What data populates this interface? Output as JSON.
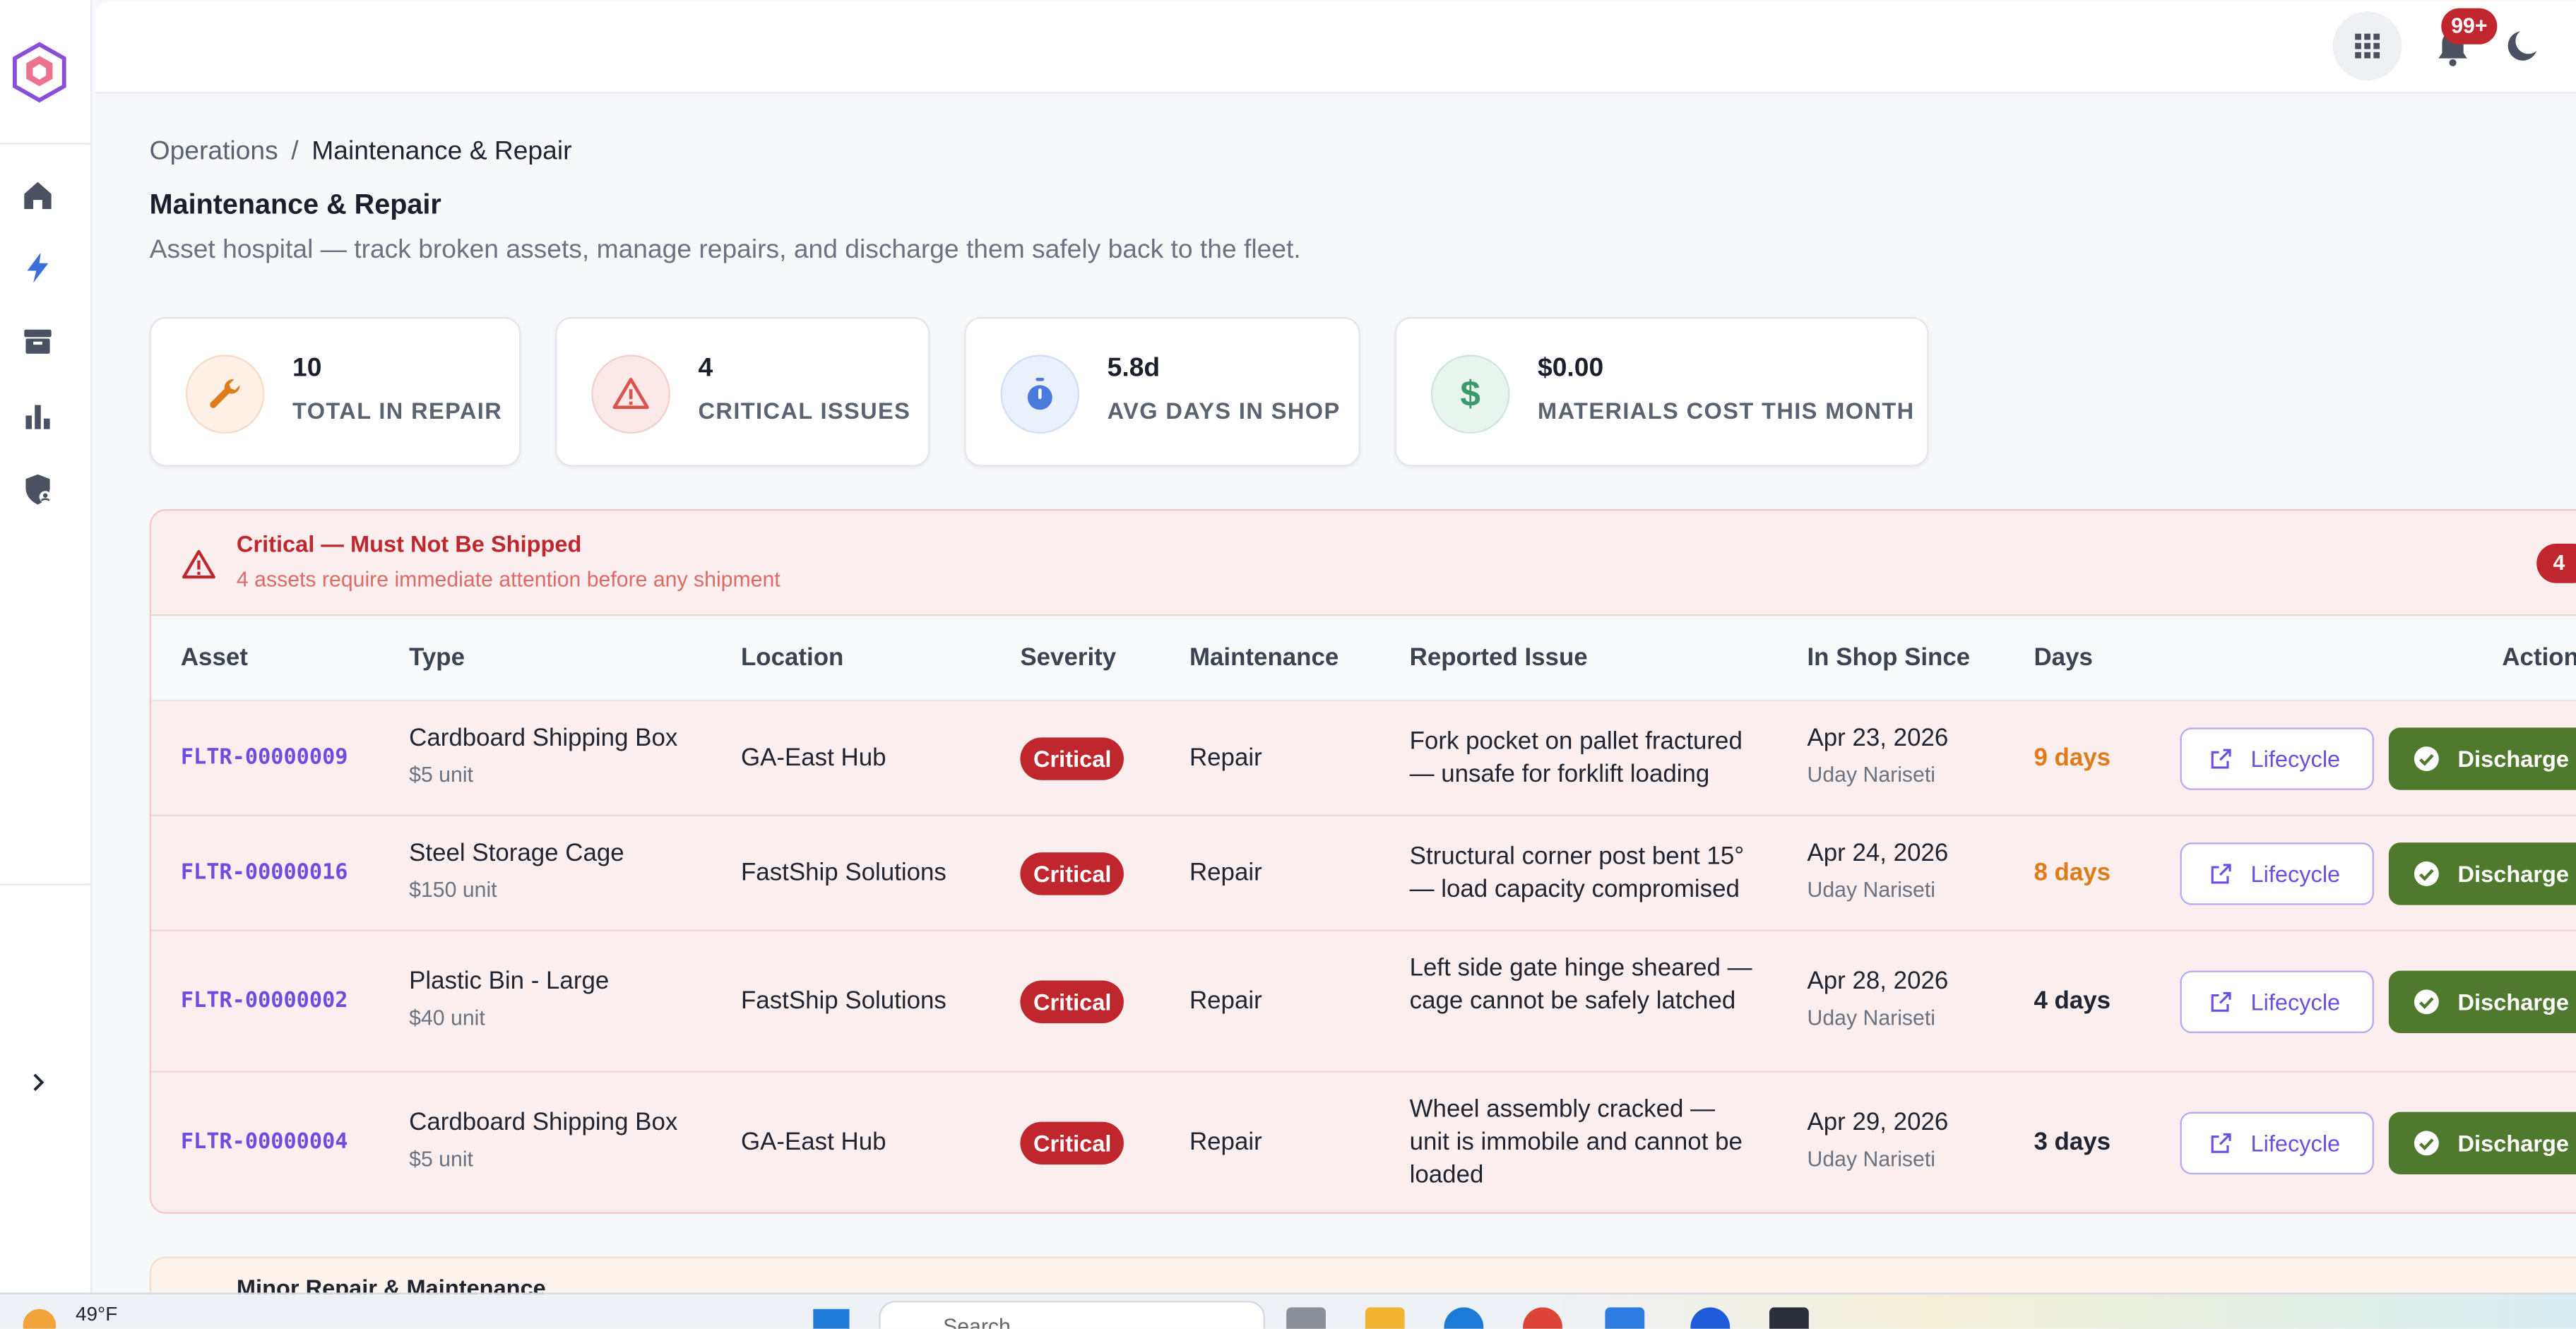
{
  "topbar": {
    "notifications_badge": "99+"
  },
  "breadcrumb": {
    "parent": "Operations",
    "separator": "/",
    "current": "Maintenance & Repair"
  },
  "page": {
    "title": "Maintenance & Repair",
    "subtitle": "Asset hospital — track broken assets, manage repairs, and discharge them safely back to the fleet."
  },
  "stats": [
    {
      "value": "10",
      "label": "Total in Repair",
      "icon": "wrench-icon",
      "color": "#e07b1a",
      "bg": "#fdf0e6"
    },
    {
      "value": "4",
      "label": "Critical Issues",
      "icon": "warning-triangle-icon",
      "color": "#d9534f",
      "bg": "#fbe9e9"
    },
    {
      "value": "5.8d",
      "label": "Avg Days in Shop",
      "icon": "stopwatch-icon",
      "color": "#4a7bdc",
      "bg": "#eaf0fc"
    },
    {
      "value": "$0.00",
      "label": "Materials Cost This Month",
      "icon": "dollar-icon",
      "color": "#3a9a6c",
      "bg": "#e8f5ee"
    }
  ],
  "critical": {
    "title": "Critical — Must Not Be Shipped",
    "subtitle": "4 assets require immediate attention before any shipment",
    "count": "4"
  },
  "table": {
    "headers": {
      "asset": "Asset",
      "type": "Type",
      "location": "Location",
      "severity": "Severity",
      "maintenance": "Maintenance",
      "issue": "Reported Issue",
      "since": "In Shop Since",
      "days": "Days",
      "actions": "Actions"
    },
    "rows": [
      {
        "asset": "FLTR-00000009",
        "type": "Cardboard Shipping Box",
        "unit": "$5 unit",
        "location": "GA-East Hub",
        "severity": "Critical",
        "maintenance": "Repair",
        "issue": "Fork pocket on pallet fractured — unsafe for forklift loading",
        "date": "Apr 23, 2026",
        "user": "Uday Nariseti",
        "days": "9 days",
        "overdue": true
      },
      {
        "asset": "FLTR-00000016",
        "type": "Steel Storage Cage",
        "unit": "$150 unit",
        "location": "FastShip Solutions",
        "severity": "Critical",
        "maintenance": "Repair",
        "issue": "Structural corner post bent 15° — load capacity compromised",
        "date": "Apr 24, 2026",
        "user": "Uday Nariseti",
        "days": "8 days",
        "overdue": true
      },
      {
        "asset": "FLTR-00000002",
        "type": "Plastic Bin - Large",
        "unit": "$40 unit",
        "location": "FastShip Solutions",
        "severity": "Critical",
        "maintenance": "Repair",
        "issue": "Left side gate hinge sheared — cage cannot be safely latched",
        "date": "Apr 28, 2026",
        "user": "Uday Nariseti",
        "days": "4 days",
        "overdue": false
      },
      {
        "asset": "FLTR-00000004",
        "type": "Cardboard Shipping Box",
        "unit": "$5 unit",
        "location": "GA-East Hub",
        "severity": "Critical",
        "maintenance": "Repair",
        "issue": "Wheel assembly cracked — unit is immobile and cannot be loaded",
        "date": "Apr 29, 2026",
        "user": "Uday Nariseti",
        "days": "3 days",
        "overdue": false
      }
    ],
    "lifecycle_label": "Lifecycle",
    "discharge_label": "Discharge"
  },
  "next_section": {
    "title": "Minor Repair & Maintenance"
  },
  "taskbar": {
    "temperature": "49°F",
    "search_placeholder": "Search"
  },
  "colors": {
    "accent": "#6d4ce0",
    "critical": "#c0262d",
    "discharge": "#4f7a2e",
    "warning": "#e07b1a"
  }
}
